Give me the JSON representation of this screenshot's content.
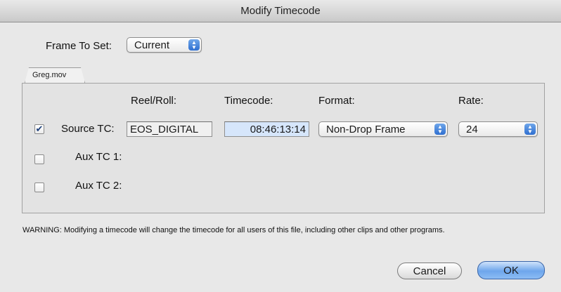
{
  "window": {
    "title": "Modify Timecode"
  },
  "frame_to_set": {
    "label": "Frame To Set:",
    "value": "Current"
  },
  "tab": {
    "label": "Greg.mov"
  },
  "columns": {
    "reel": "Reel/Roll:",
    "timecode": "Timecode:",
    "format": "Format:",
    "rate": "Rate:"
  },
  "rows": [
    {
      "label": "Source TC:",
      "checked": true,
      "checkmark": "✔",
      "reel": "EOS_DIGITAL",
      "timecode": "08:46:13:14",
      "format": "Non-Drop Frame",
      "rate": "24"
    },
    {
      "label": "Aux TC 1:",
      "checked": false
    },
    {
      "label": "Aux TC 2:",
      "checked": false
    }
  ],
  "warning": "WARNING: Modifying a timecode will change the timecode for all users of this file, including other clips and other programs.",
  "buttons": {
    "cancel": "Cancel",
    "ok": "OK"
  },
  "colors": {
    "accent": "#3f84e5",
    "timecode_field": "#d6e6fb"
  }
}
